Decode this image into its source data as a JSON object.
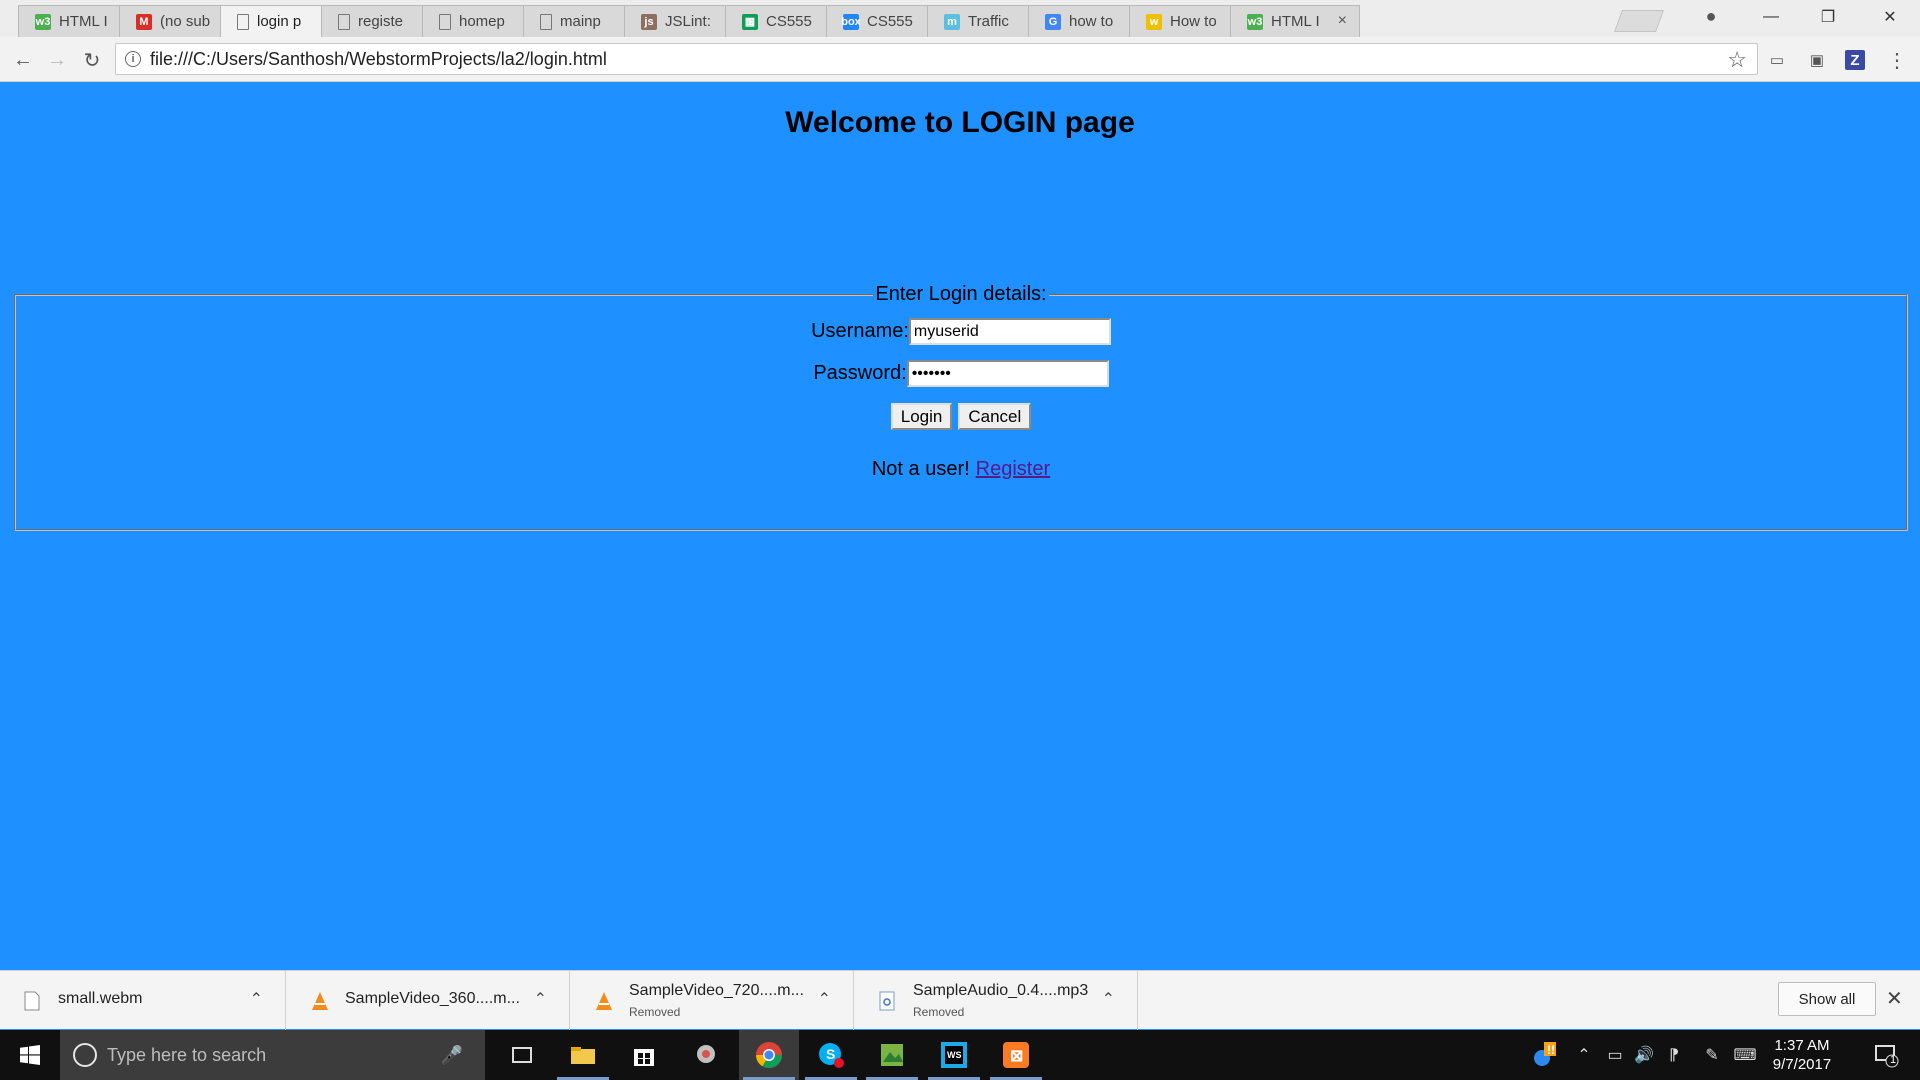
{
  "browser": {
    "tabs": [
      {
        "title": "HTML I",
        "icon": "w3schools-icon",
        "color": "#4caf50",
        "glyph": "w3"
      },
      {
        "title": "(no sub",
        "icon": "gmail-icon",
        "color": "#d93025",
        "glyph": "M"
      },
      {
        "title": "login p",
        "icon": "page-icon",
        "color": "",
        "glyph": "",
        "active": true
      },
      {
        "title": "registe",
        "icon": "page-icon",
        "color": "",
        "glyph": ""
      },
      {
        "title": "homep",
        "icon": "page-icon",
        "color": "",
        "glyph": ""
      },
      {
        "title": "mainp",
        "icon": "page-icon",
        "color": "",
        "glyph": ""
      },
      {
        "title": "JSLint:",
        "icon": "jslint-icon",
        "color": "#8d6e63",
        "glyph": "js"
      },
      {
        "title": "CS555",
        "icon": "sheets-icon",
        "color": "#0f9d58",
        "glyph": "▦"
      },
      {
        "title": "CS555",
        "icon": "box-icon",
        "color": "#2486fc",
        "glyph": "box"
      },
      {
        "title": "Traffic",
        "icon": "mailchimp-icon",
        "color": "#5bc0de",
        "glyph": "m"
      },
      {
        "title": "how to",
        "icon": "google-icon",
        "color": "#4285f4",
        "glyph": "G"
      },
      {
        "title": "How to",
        "icon": "wikihow-icon",
        "color": "#f0c000",
        "glyph": "w"
      },
      {
        "title": "HTML I",
        "icon": "w3schools-icon",
        "color": "#4caf50",
        "glyph": "w3"
      }
    ],
    "url": "file:///C:/Users/Santhosh/WebstormProjects/la2/login.html"
  },
  "page": {
    "heading": "Welcome to LOGIN page",
    "legend": "Enter Login details:",
    "username_label": "Username:",
    "username_value": "myuserid",
    "password_label": "Password:",
    "password_value": "1234567",
    "login_button": "Login",
    "cancel_button": "Cancel",
    "not_user_text": "Not a user!",
    "register_link": "Register"
  },
  "downloads": {
    "items": [
      {
        "name": "small.webm",
        "status": "",
        "icon": "file-icon"
      },
      {
        "name": "SampleVideo_360....m...",
        "status": "",
        "icon": "vlc-icon"
      },
      {
        "name": "SampleVideo_720....m...",
        "status": "Removed",
        "icon": "vlc-icon"
      },
      {
        "name": "SampleAudio_0.4....mp3",
        "status": "Removed",
        "icon": "audio-file-icon"
      }
    ],
    "show_all": "Show all"
  },
  "taskbar": {
    "search_placeholder": "Type here to search",
    "time": "1:37 AM",
    "date": "9/7/2017",
    "notification_count": "1"
  },
  "colors": {
    "page_background": "#1e90ff",
    "link_visited": "#551a8b"
  }
}
